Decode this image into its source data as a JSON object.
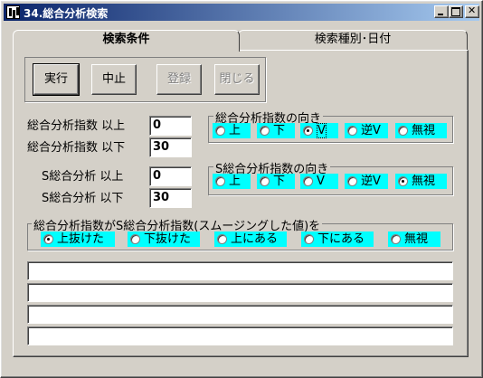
{
  "window": {
    "title": "34.総合分析検索"
  },
  "tabs": [
    {
      "label": "検索条件",
      "active": true
    },
    {
      "label": "検索種別･日付",
      "active": false
    }
  ],
  "buttons": {
    "run": "実行",
    "stop": "中止",
    "register": "登録",
    "close": "閉じる"
  },
  "filters": {
    "index_min_label": "総合分析指数 以上",
    "index_min_value": "0",
    "index_max_label": "総合分析指数 以下",
    "index_max_value": "30",
    "s_min_label": "S総合分析 以上",
    "s_min_value": "0",
    "s_max_label": "S総合分析 以下",
    "s_max_value": "30"
  },
  "direction_group": {
    "title": "総合分析指数の向き",
    "options": [
      "上",
      "下",
      "V",
      "逆V",
      "無視"
    ],
    "selected": "V"
  },
  "s_direction_group": {
    "title": "S総合分析指数の向き",
    "options": [
      "上",
      "下",
      "V",
      "逆V",
      "無視"
    ],
    "selected": "無視"
  },
  "cross_group": {
    "title": "総合分析指数がS総合分析指数(スムージングした値)を",
    "options": [
      "上抜けた",
      "下抜けた",
      "上にある",
      "下にある",
      "無視"
    ],
    "selected": "上抜けた"
  },
  "colors": {
    "face": "#d4d0c8",
    "title_bar": "#0a246a",
    "radio_bg": "#00ffff"
  }
}
